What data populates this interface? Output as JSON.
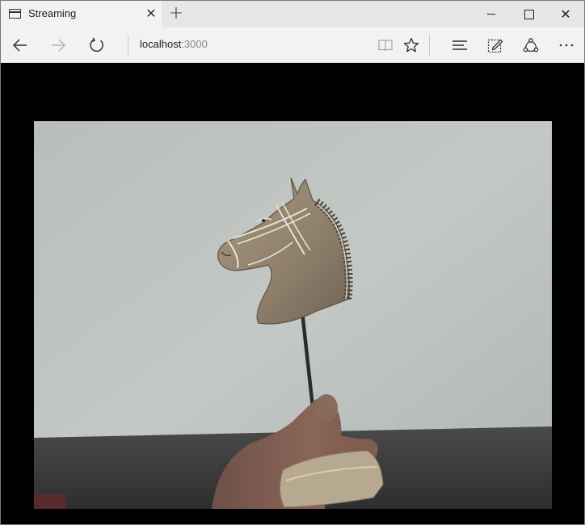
{
  "tab": {
    "title": "Streaming",
    "close_glyph": "✕",
    "new_tab_glyph": "+"
  },
  "window_controls": {
    "close_glyph": "✕"
  },
  "address": {
    "host": "localhost",
    "port": ":3000"
  },
  "icons": {
    "tab": "page-icon",
    "back": "back-arrow-icon",
    "forward": "forward-arrow-icon",
    "refresh": "refresh-icon",
    "reading_view": "book-icon",
    "favorite": "star-icon",
    "hub": "hub-lines-icon",
    "web_note": "pen-note-icon",
    "share": "share-icon",
    "more": "ellipsis-icon"
  },
  "colors": {
    "chrome_bg": "#f2f2f2",
    "titlebar_bg": "#e6e6e6",
    "page_bg": "#000000",
    "video_wall": "#b4bab7",
    "video_floor": "#3e3e3e"
  }
}
